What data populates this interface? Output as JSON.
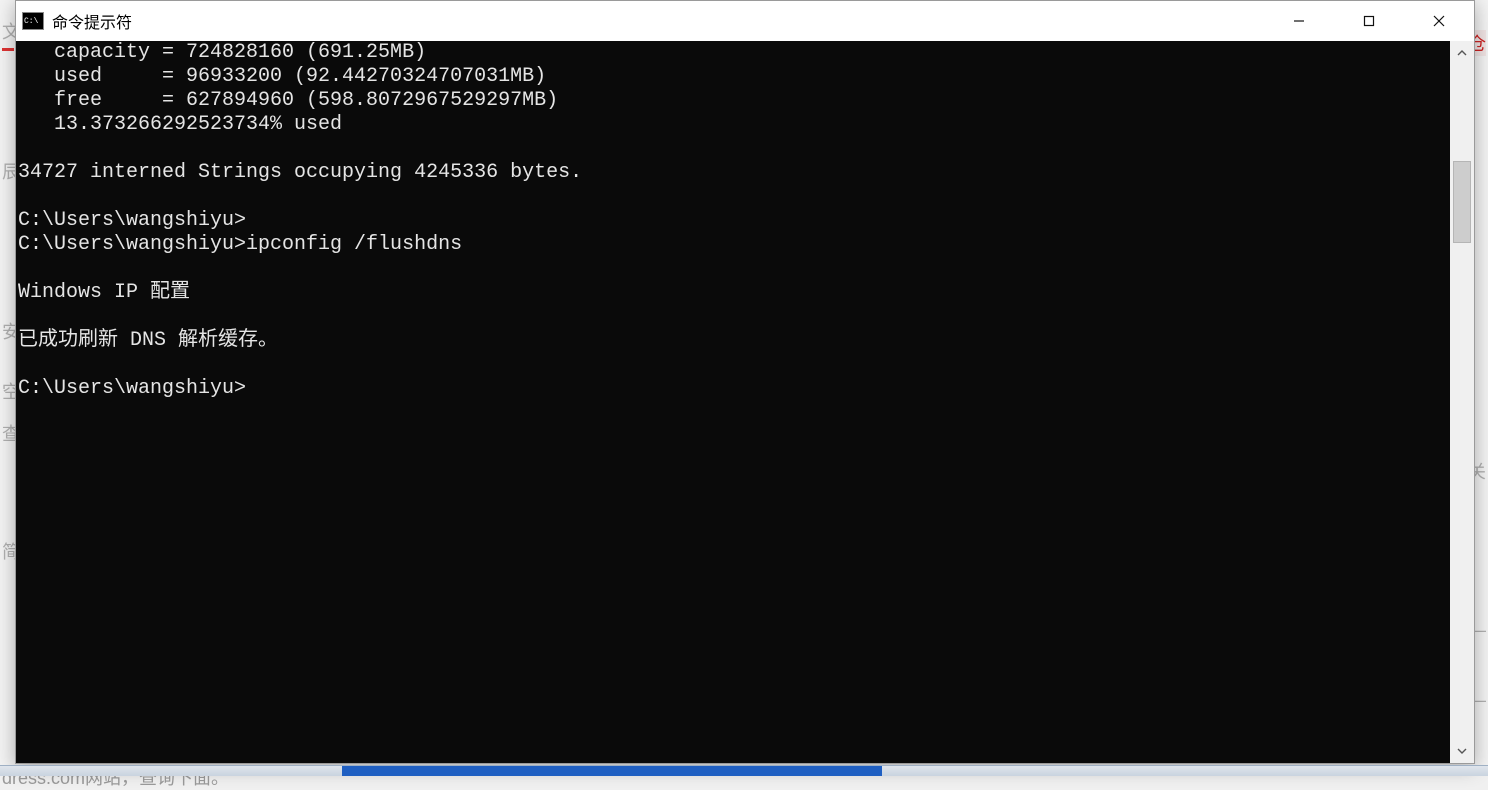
{
  "window": {
    "title": "命令提示符"
  },
  "terminal": {
    "lines": [
      "   capacity = 724828160 (691.25MB)",
      "   used     = 96933200 (92.44270324707031MB)",
      "   free     = 627894960 (598.8072967529297MB)",
      "   13.373266292523734% used",
      "",
      "34727 interned Strings occupying 4245336 bytes.",
      "",
      "C:\\Users\\wangshiyu>",
      "C:\\Users\\wangshiyu>ipconfig /flushdns",
      "",
      "Windows IP 配置",
      "",
      "已成功刷新 DNS 解析缓存。",
      "",
      "C:\\Users\\wangshiyu>"
    ]
  },
  "backdrop": {
    "t1": "文",
    "t2": "辰",
    "t3": "安",
    "t4": "空",
    "t5": "查",
    "t6": "简",
    "t7": "dress.com网站，查询下面。",
    "t8": "仓",
    "t9": "关",
    "t10": "—",
    "t11": "—"
  }
}
